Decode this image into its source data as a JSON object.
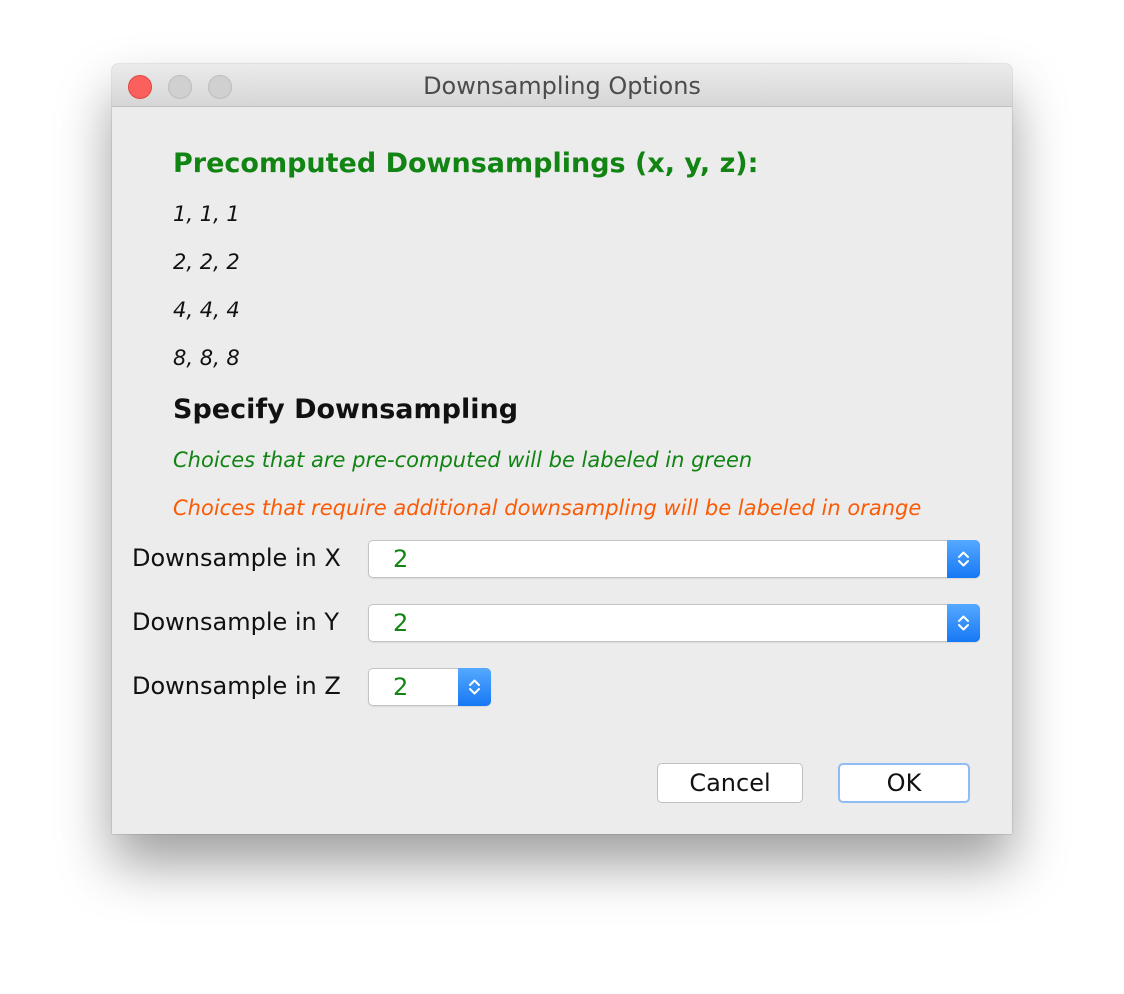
{
  "window": {
    "title": "Downsampling Options"
  },
  "precomputed": {
    "heading": "Precomputed Downsamplings (x, y, z):",
    "items": [
      "1, 1, 1",
      "2, 2, 2",
      "4, 4, 4",
      "8, 8, 8"
    ]
  },
  "specify": {
    "heading": "Specify Downsampling",
    "note_green": "Choices that are pre-computed will be labeled in green",
    "note_orange": "Choices that require additional downsampling will be labeled in orange"
  },
  "fields": [
    {
      "label": "Downsample in X",
      "value": "2"
    },
    {
      "label": "Downsample in Y",
      "value": "2"
    },
    {
      "label": "Downsample in Z",
      "value": "2"
    }
  ],
  "buttons": {
    "cancel": "Cancel",
    "ok": "OK"
  },
  "colors": {
    "precomputed_green": "#118413",
    "additional_orange": "#fb5b06",
    "accent_blue": "#1678f4"
  }
}
